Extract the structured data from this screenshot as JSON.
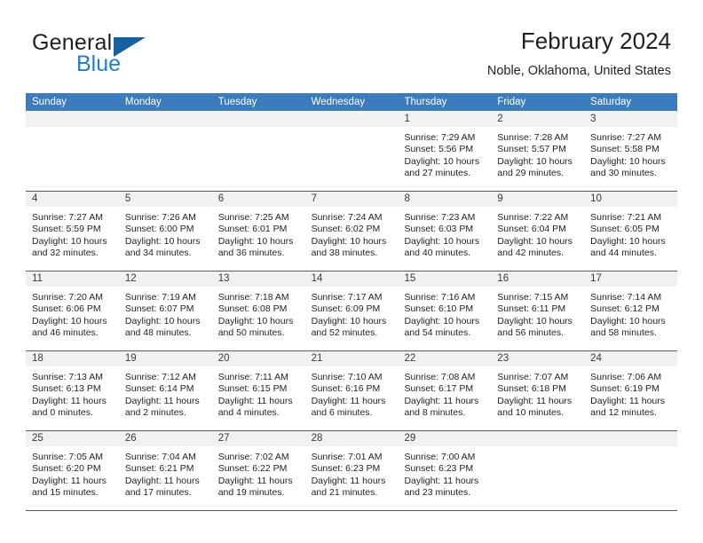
{
  "brand": {
    "name_top": "General",
    "name_bottom": "Blue",
    "accent_color": "#1461a4",
    "blue_text_color": "#1f7fc4"
  },
  "header": {
    "title": "February 2024",
    "subtitle": "Noble, Oklahoma, United States"
  },
  "calendar": {
    "header_bg": "#3b7cbf",
    "header_text_color": "#ffffff",
    "daynumber_band_bg": "#f1f1f1",
    "weekday_names": [
      "Sunday",
      "Monday",
      "Tuesday",
      "Wednesday",
      "Thursday",
      "Friday",
      "Saturday"
    ],
    "weeks": [
      [
        {
          "empty": true
        },
        {
          "empty": true
        },
        {
          "empty": true
        },
        {
          "empty": true
        },
        {
          "day": "1",
          "sunrise": "Sunrise: 7:29 AM",
          "sunset": "Sunset: 5:56 PM",
          "daylight_line1": "Daylight: 10 hours",
          "daylight_line2": "and 27 minutes."
        },
        {
          "day": "2",
          "sunrise": "Sunrise: 7:28 AM",
          "sunset": "Sunset: 5:57 PM",
          "daylight_line1": "Daylight: 10 hours",
          "daylight_line2": "and 29 minutes."
        },
        {
          "day": "3",
          "sunrise": "Sunrise: 7:27 AM",
          "sunset": "Sunset: 5:58 PM",
          "daylight_line1": "Daylight: 10 hours",
          "daylight_line2": "and 30 minutes."
        }
      ],
      [
        {
          "day": "4",
          "sunrise": "Sunrise: 7:27 AM",
          "sunset": "Sunset: 5:59 PM",
          "daylight_line1": "Daylight: 10 hours",
          "daylight_line2": "and 32 minutes."
        },
        {
          "day": "5",
          "sunrise": "Sunrise: 7:26 AM",
          "sunset": "Sunset: 6:00 PM",
          "daylight_line1": "Daylight: 10 hours",
          "daylight_line2": "and 34 minutes."
        },
        {
          "day": "6",
          "sunrise": "Sunrise: 7:25 AM",
          "sunset": "Sunset: 6:01 PM",
          "daylight_line1": "Daylight: 10 hours",
          "daylight_line2": "and 36 minutes."
        },
        {
          "day": "7",
          "sunrise": "Sunrise: 7:24 AM",
          "sunset": "Sunset: 6:02 PM",
          "daylight_line1": "Daylight: 10 hours",
          "daylight_line2": "and 38 minutes."
        },
        {
          "day": "8",
          "sunrise": "Sunrise: 7:23 AM",
          "sunset": "Sunset: 6:03 PM",
          "daylight_line1": "Daylight: 10 hours",
          "daylight_line2": "and 40 minutes."
        },
        {
          "day": "9",
          "sunrise": "Sunrise: 7:22 AM",
          "sunset": "Sunset: 6:04 PM",
          "daylight_line1": "Daylight: 10 hours",
          "daylight_line2": "and 42 minutes."
        },
        {
          "day": "10",
          "sunrise": "Sunrise: 7:21 AM",
          "sunset": "Sunset: 6:05 PM",
          "daylight_line1": "Daylight: 10 hours",
          "daylight_line2": "and 44 minutes."
        }
      ],
      [
        {
          "day": "11",
          "sunrise": "Sunrise: 7:20 AM",
          "sunset": "Sunset: 6:06 PM",
          "daylight_line1": "Daylight: 10 hours",
          "daylight_line2": "and 46 minutes."
        },
        {
          "day": "12",
          "sunrise": "Sunrise: 7:19 AM",
          "sunset": "Sunset: 6:07 PM",
          "daylight_line1": "Daylight: 10 hours",
          "daylight_line2": "and 48 minutes."
        },
        {
          "day": "13",
          "sunrise": "Sunrise: 7:18 AM",
          "sunset": "Sunset: 6:08 PM",
          "daylight_line1": "Daylight: 10 hours",
          "daylight_line2": "and 50 minutes."
        },
        {
          "day": "14",
          "sunrise": "Sunrise: 7:17 AM",
          "sunset": "Sunset: 6:09 PM",
          "daylight_line1": "Daylight: 10 hours",
          "daylight_line2": "and 52 minutes."
        },
        {
          "day": "15",
          "sunrise": "Sunrise: 7:16 AM",
          "sunset": "Sunset: 6:10 PM",
          "daylight_line1": "Daylight: 10 hours",
          "daylight_line2": "and 54 minutes."
        },
        {
          "day": "16",
          "sunrise": "Sunrise: 7:15 AM",
          "sunset": "Sunset: 6:11 PM",
          "daylight_line1": "Daylight: 10 hours",
          "daylight_line2": "and 56 minutes."
        },
        {
          "day": "17",
          "sunrise": "Sunrise: 7:14 AM",
          "sunset": "Sunset: 6:12 PM",
          "daylight_line1": "Daylight: 10 hours",
          "daylight_line2": "and 58 minutes."
        }
      ],
      [
        {
          "day": "18",
          "sunrise": "Sunrise: 7:13 AM",
          "sunset": "Sunset: 6:13 PM",
          "daylight_line1": "Daylight: 11 hours",
          "daylight_line2": "and 0 minutes."
        },
        {
          "day": "19",
          "sunrise": "Sunrise: 7:12 AM",
          "sunset": "Sunset: 6:14 PM",
          "daylight_line1": "Daylight: 11 hours",
          "daylight_line2": "and 2 minutes."
        },
        {
          "day": "20",
          "sunrise": "Sunrise: 7:11 AM",
          "sunset": "Sunset: 6:15 PM",
          "daylight_line1": "Daylight: 11 hours",
          "daylight_line2": "and 4 minutes."
        },
        {
          "day": "21",
          "sunrise": "Sunrise: 7:10 AM",
          "sunset": "Sunset: 6:16 PM",
          "daylight_line1": "Daylight: 11 hours",
          "daylight_line2": "and 6 minutes."
        },
        {
          "day": "22",
          "sunrise": "Sunrise: 7:08 AM",
          "sunset": "Sunset: 6:17 PM",
          "daylight_line1": "Daylight: 11 hours",
          "daylight_line2": "and 8 minutes."
        },
        {
          "day": "23",
          "sunrise": "Sunrise: 7:07 AM",
          "sunset": "Sunset: 6:18 PM",
          "daylight_line1": "Daylight: 11 hours",
          "daylight_line2": "and 10 minutes."
        },
        {
          "day": "24",
          "sunrise": "Sunrise: 7:06 AM",
          "sunset": "Sunset: 6:19 PM",
          "daylight_line1": "Daylight: 11 hours",
          "daylight_line2": "and 12 minutes."
        }
      ],
      [
        {
          "day": "25",
          "sunrise": "Sunrise: 7:05 AM",
          "sunset": "Sunset: 6:20 PM",
          "daylight_line1": "Daylight: 11 hours",
          "daylight_line2": "and 15 minutes."
        },
        {
          "day": "26",
          "sunrise": "Sunrise: 7:04 AM",
          "sunset": "Sunset: 6:21 PM",
          "daylight_line1": "Daylight: 11 hours",
          "daylight_line2": "and 17 minutes."
        },
        {
          "day": "27",
          "sunrise": "Sunrise: 7:02 AM",
          "sunset": "Sunset: 6:22 PM",
          "daylight_line1": "Daylight: 11 hours",
          "daylight_line2": "and 19 minutes."
        },
        {
          "day": "28",
          "sunrise": "Sunrise: 7:01 AM",
          "sunset": "Sunset: 6:23 PM",
          "daylight_line1": "Daylight: 11 hours",
          "daylight_line2": "and 21 minutes."
        },
        {
          "day": "29",
          "sunrise": "Sunrise: 7:00 AM",
          "sunset": "Sunset: 6:23 PM",
          "daylight_line1": "Daylight: 11 hours",
          "daylight_line2": "and 23 minutes."
        },
        {
          "empty": true
        },
        {
          "empty": true
        }
      ]
    ]
  }
}
